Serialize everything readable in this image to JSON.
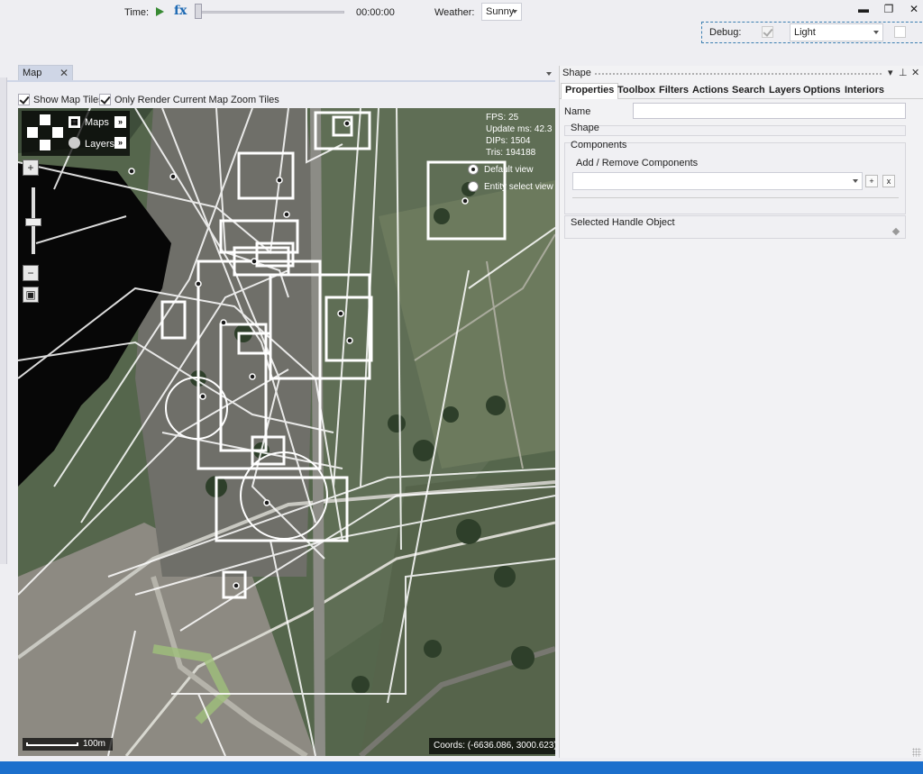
{
  "toolbar": {
    "time_label": "Time:",
    "time_value": "00:00:00",
    "weather_label": "Weather:",
    "weather_value": "Sunny",
    "debug_label": "Debug:",
    "debug_mode_value": "Light",
    "play_icon": "play-icon",
    "fx_icon": "fx-icon"
  },
  "window_controls": {
    "minimize": "▬",
    "restore": "❐",
    "close": "✕"
  },
  "map_panel": {
    "tab_label": "Map",
    "tab_close": "✕",
    "show_map_tiles_label": "Show Map Tiles",
    "show_map_tiles_checked": true,
    "zoom_tiles_label": "Only Render Current Map Zoom Tiles",
    "zoom_tiles_checked": true,
    "maps_label": "Maps",
    "layers_label": "Layers",
    "zoom_in": "+",
    "zoom_out": "−",
    "zoom_fit": "▣",
    "stats": {
      "fps": "FPS: 25",
      "update": "Update ms: 42.3",
      "dips": "DIPs: 1504",
      "tris": "Tris: 194188"
    },
    "view_options": {
      "default_view": "Default view",
      "entity_select_view": "Entity select view"
    },
    "scale_label": "100m",
    "coords": "Coords: (-6636.086, 3000.623)"
  },
  "shape_panel": {
    "title": "Shape",
    "tabs": [
      "Properties",
      "Toolbox",
      "Filters",
      "Actions",
      "Search",
      "Layers",
      "Options",
      "Interiors"
    ],
    "active_tab": "Properties",
    "name_label": "Name",
    "name_value": "",
    "shape_group": "Shape",
    "components_group": "Components",
    "add_remove_label": "Add / Remove Components",
    "add_button": "+",
    "remove_button": "x",
    "selected_handle_group": "Selected Handle Object"
  },
  "colors": {
    "status_bar": "#1c6fcc",
    "accent": "#3c7fb1",
    "play_green": "#388a34"
  }
}
